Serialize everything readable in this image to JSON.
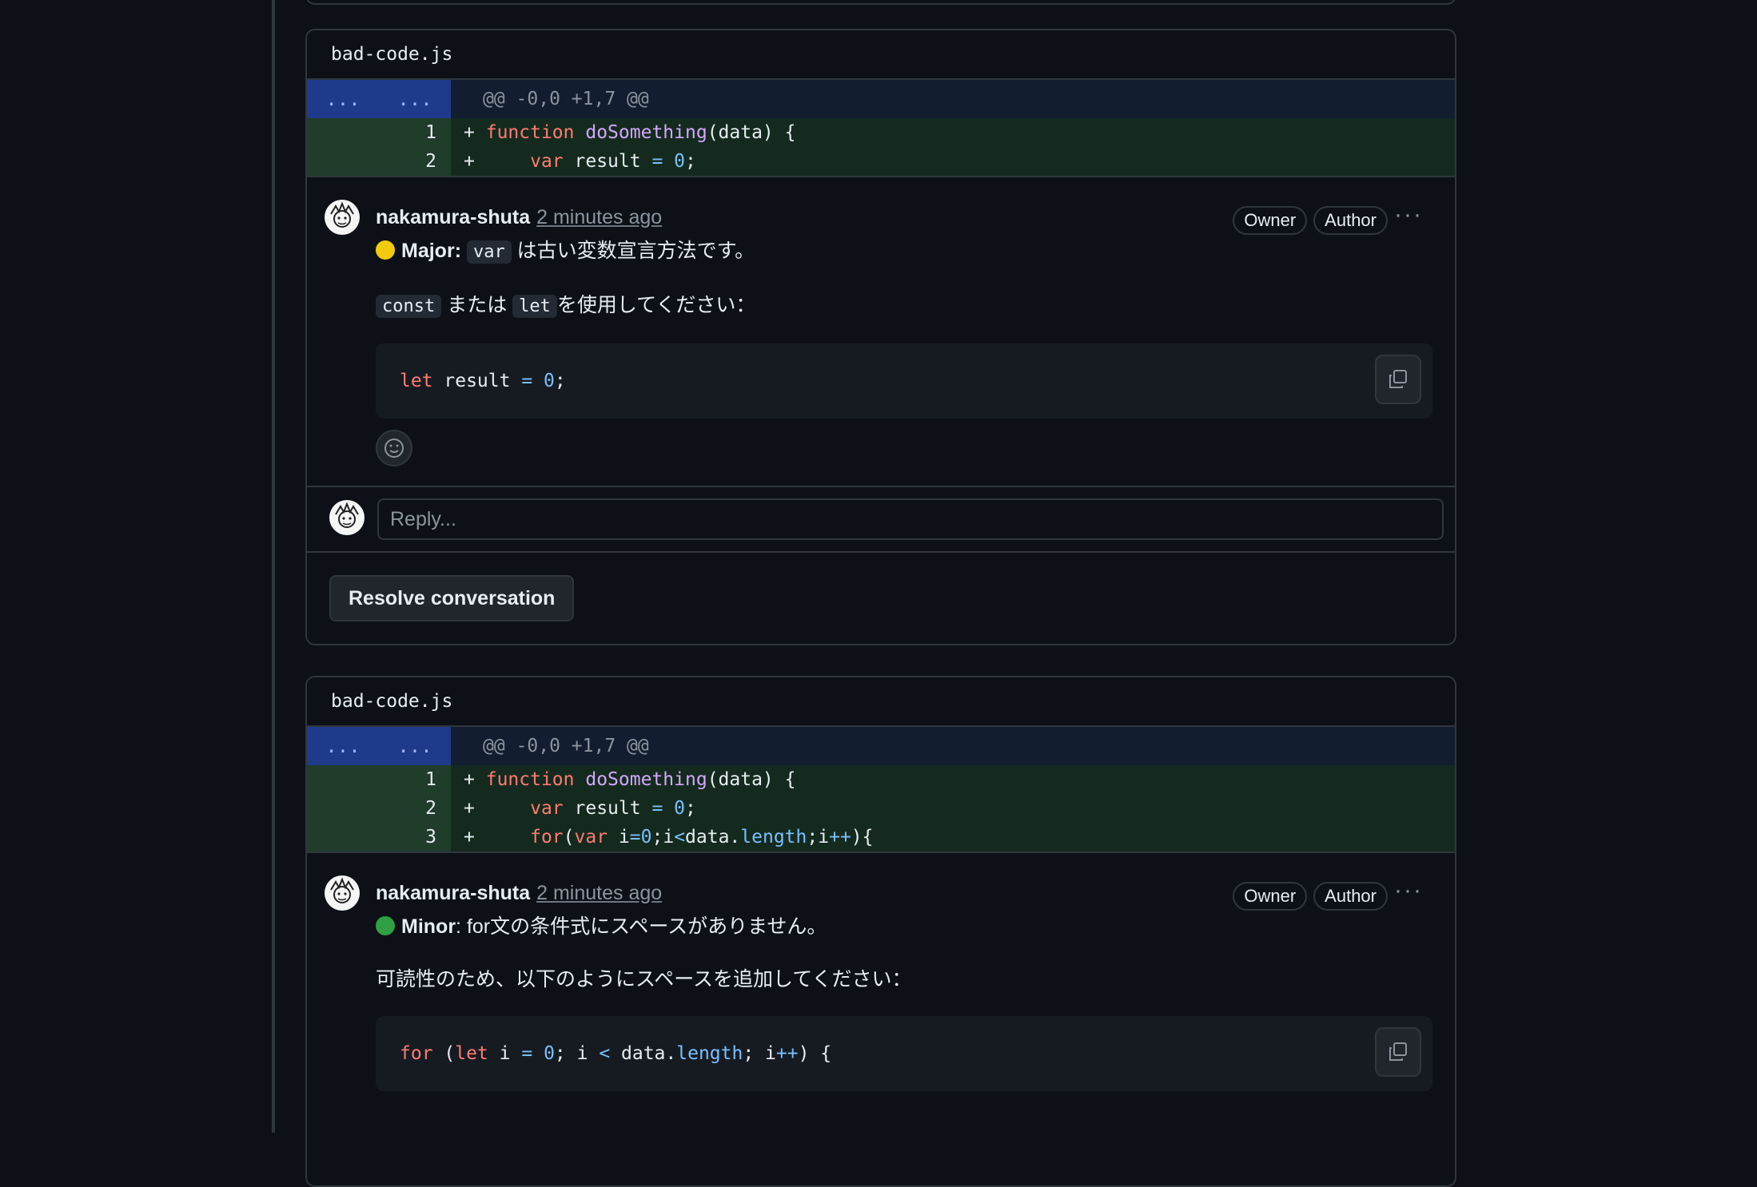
{
  "threads": [
    {
      "file_name": "bad-code.js",
      "hunk_left": "...",
      "hunk_right": "...",
      "hunk_header": "@@ -0,0 +1,7 @@",
      "lines": [
        {
          "num": "1",
          "sign": "+"
        },
        {
          "num": "2",
          "sign": "+"
        }
      ],
      "comment": {
        "author": "nakamura-shuta",
        "time": "2 minutes ago",
        "badge_owner": "Owner",
        "badge_author": "Author",
        "severity_label": "Major",
        "severity_color": "#f2cc0c",
        "line1_code": "var",
        "line1_text": "は古い変数宣言方法です。",
        "line2_code_a": "const",
        "line2_mid": "または",
        "line2_code_b": "let",
        "line2_text": "を使用してください："
      },
      "reply_placeholder": "Reply...",
      "resolve_label": "Resolve conversation"
    },
    {
      "file_name": "bad-code.js",
      "hunk_left": "...",
      "hunk_right": "...",
      "hunk_header": "@@ -0,0 +1,7 @@",
      "lines": [
        {
          "num": "1",
          "sign": "+"
        },
        {
          "num": "2",
          "sign": "+"
        },
        {
          "num": "3",
          "sign": "+"
        }
      ],
      "comment": {
        "author": "nakamura-shuta",
        "time": "2 minutes ago",
        "badge_owner": "Owner",
        "badge_author": "Author",
        "severity_label": "Minor",
        "severity_color": "#2ea043",
        "line1_text": ": for文の条件式にスペースがありません。",
        "line2_text": "可読性のため、以下のようにスペースを追加してください："
      }
    }
  ],
  "icons": {
    "avatar": "avatar-icon",
    "copy": "copy-icon",
    "emoji": "smiley-icon",
    "more": "kebab-icon"
  }
}
